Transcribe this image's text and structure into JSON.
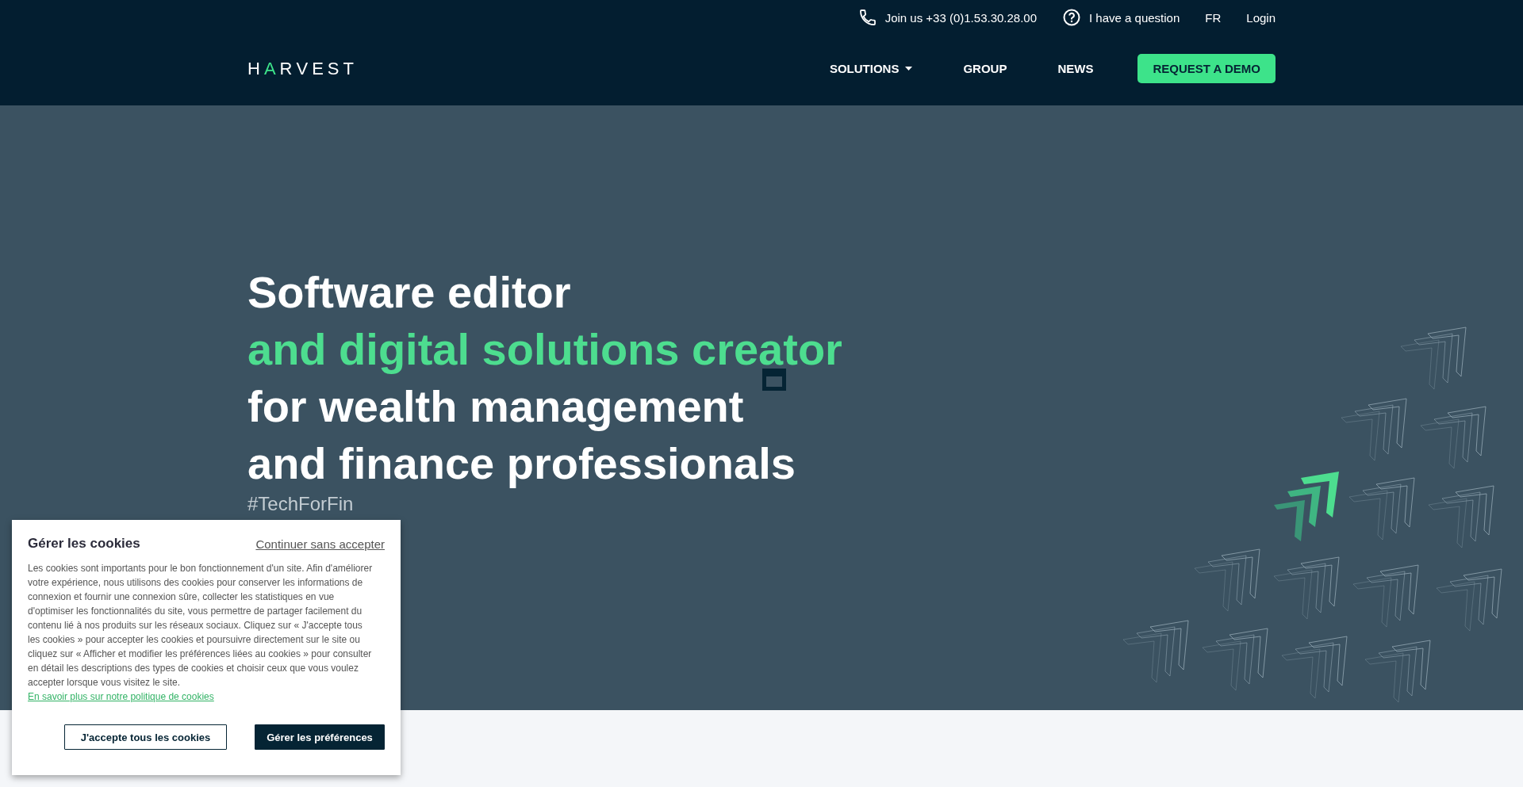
{
  "header": {
    "logo": "HARVEST",
    "top_links": [
      {
        "kind": "phone",
        "label": "Join us +33 (0)1.53.30.28.00"
      },
      {
        "kind": "question",
        "label": "I have a question"
      },
      {
        "kind": "plain",
        "label": "FR"
      },
      {
        "kind": "plain",
        "label": "Login"
      }
    ],
    "nav": [
      {
        "label": "SOLUTIONS",
        "dropdown": true
      },
      {
        "label": "GROUP",
        "dropdown": false
      },
      {
        "label": "NEWS",
        "dropdown": false
      }
    ],
    "cta": "REQUEST A DEMO"
  },
  "hero": {
    "lines": [
      {
        "text": "Software editor",
        "highlight": false
      },
      {
        "text": "and digital solutions creator",
        "highlight": true
      },
      {
        "text": "for wealth management",
        "highlight": false
      },
      {
        "text": "and finance professionals",
        "highlight": false
      }
    ],
    "tagline": "#TechForFin"
  },
  "cookie_banner": {
    "title": "Gérer les cookies",
    "skip_link": "Continuer sans accepter",
    "body": "Les cookies sont importants pour le bon fonctionnement d'un site. Afin d'améliorer votre expérience, nous utilisons des cookies pour conserver les informations de connexion et fournir une connexion sûre, collecter les statistiques en vue d'optimiser les fonctionnalités du site, vous permettre de partager facilement du contenu lié à nos produits sur les réseaux sociaux. Cliquez sur « J'accepte tous les cookies » pour accepter les cookies et poursuivre directement sur le site ou cliquez sur « Afficher et modifier les préférences liées au cookies » pour consulter en détail les descriptions des types de cookies et choisir ceux que vous voulez accepter lorsque vous visitez le site.",
    "policy_link": "En savoir plus sur notre politique de cookies",
    "buttons": [
      {
        "label": "J'accepte tous les cookies",
        "kind": "outline"
      },
      {
        "label": "Gérer les préférences",
        "kind": "filled"
      }
    ]
  }
}
